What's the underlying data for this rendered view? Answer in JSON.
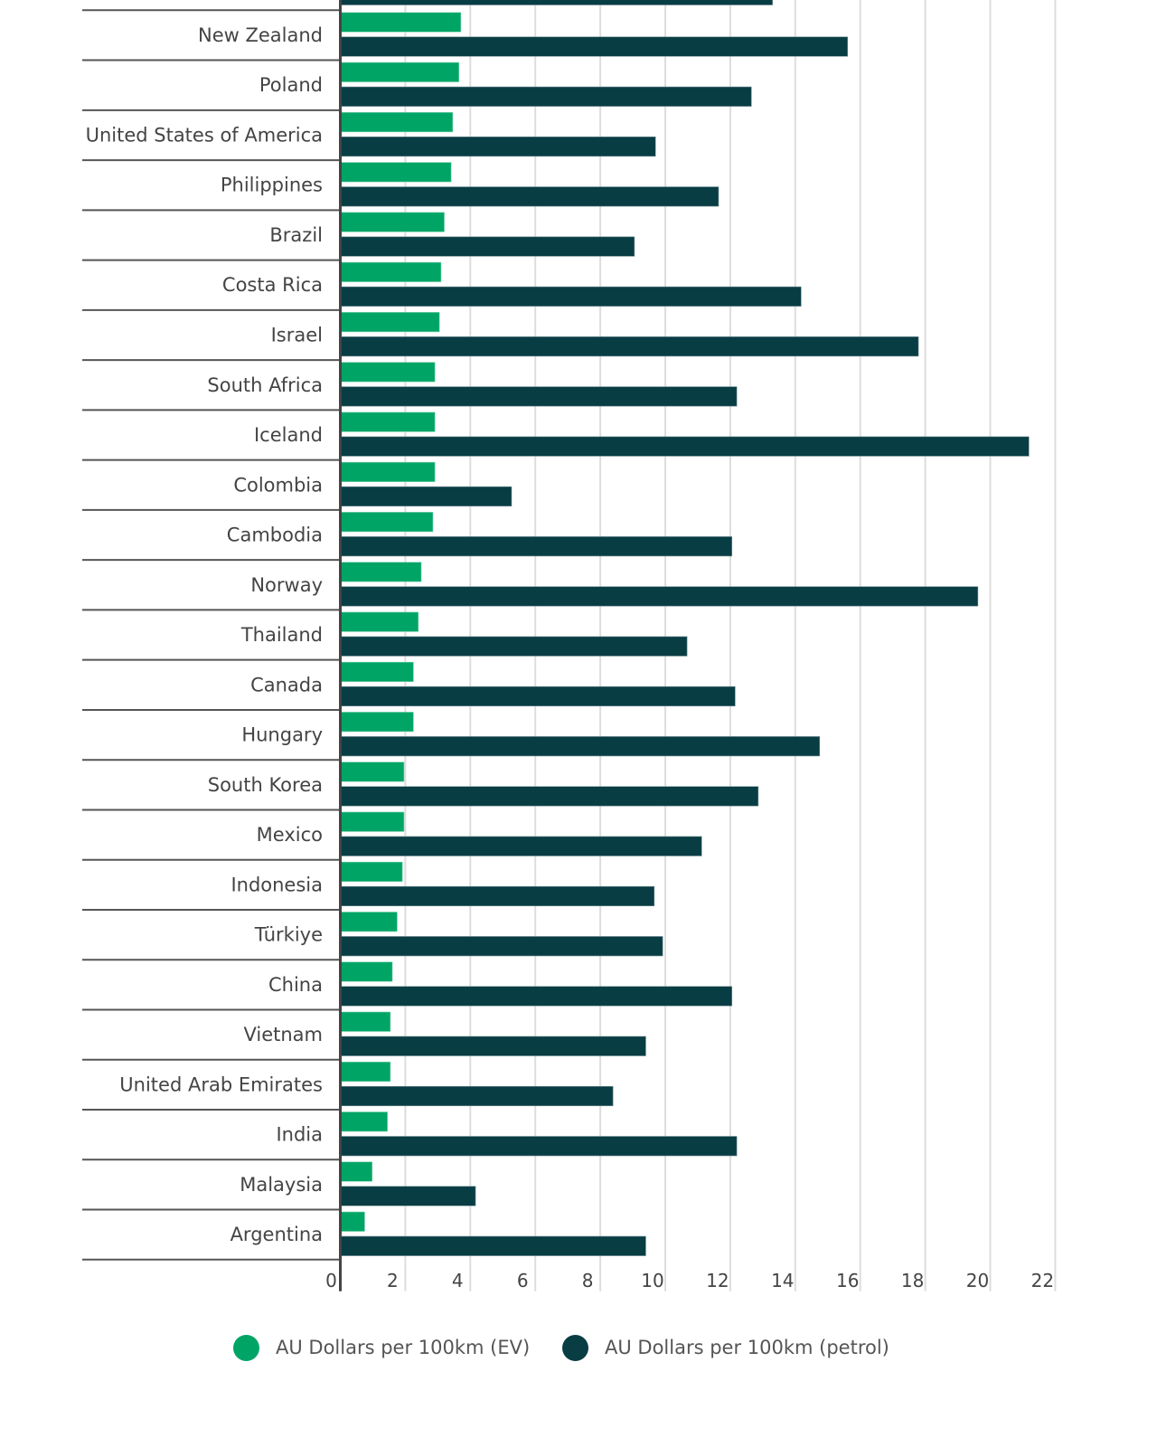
{
  "chart_data": {
    "type": "bar",
    "orientation": "horizontal",
    "title": "",
    "xlabel": "",
    "ylabel": "",
    "xlim": [
      0,
      22
    ],
    "x_ticks": [
      "0",
      "2",
      "4",
      "6",
      "8",
      "10",
      "12",
      "14",
      "16",
      "18",
      "20",
      "22"
    ],
    "grid": true,
    "legend_position": "bottom",
    "truncated_top_row": {
      "label": "",
      "petrol": 13.3
    },
    "categories": [
      "New Zealand",
      "Poland",
      "United States of America",
      "Philippines",
      "Brazil",
      "Costa Rica",
      "Israel",
      "South Africa",
      "Iceland",
      "Colombia",
      "Cambodia",
      "Norway",
      "Thailand",
      "Canada",
      "Hungary",
      "South Korea",
      "Mexico",
      "Indonesia",
      "Türkiye",
      "China",
      "Vietnam",
      "United Arab Emirates",
      "India",
      "Malaysia",
      "Argentina"
    ],
    "series": [
      {
        "name": "AU Dollars per 100km (EV)",
        "color": "#00a566",
        "values": [
          3.71,
          3.65,
          3.46,
          3.41,
          3.2,
          3.1,
          3.05,
          2.91,
          2.91,
          2.91,
          2.85,
          2.49,
          2.4,
          2.25,
          2.25,
          1.96,
          1.96,
          1.91,
          1.75,
          1.6,
          1.54,
          1.54,
          1.45,
          0.98,
          0.75
        ]
      },
      {
        "name": "AU Dollars per 100km (petrol)",
        "color": "#083d44",
        "values": [
          15.61,
          12.65,
          9.7,
          11.64,
          9.05,
          14.18,
          17.79,
          12.2,
          21.19,
          5.27,
          12.05,
          19.62,
          10.67,
          12.15,
          14.75,
          12.86,
          11.12,
          9.66,
          9.92,
          12.05,
          9.4,
          8.39,
          12.2,
          4.16,
          9.4
        ]
      }
    ]
  },
  "legend": {
    "items": [
      {
        "label": "AU Dollars per 100km (EV)",
        "color": "#00a566"
      },
      {
        "label": "AU Dollars per 100km (petrol)",
        "color": "#083d44"
      }
    ]
  }
}
